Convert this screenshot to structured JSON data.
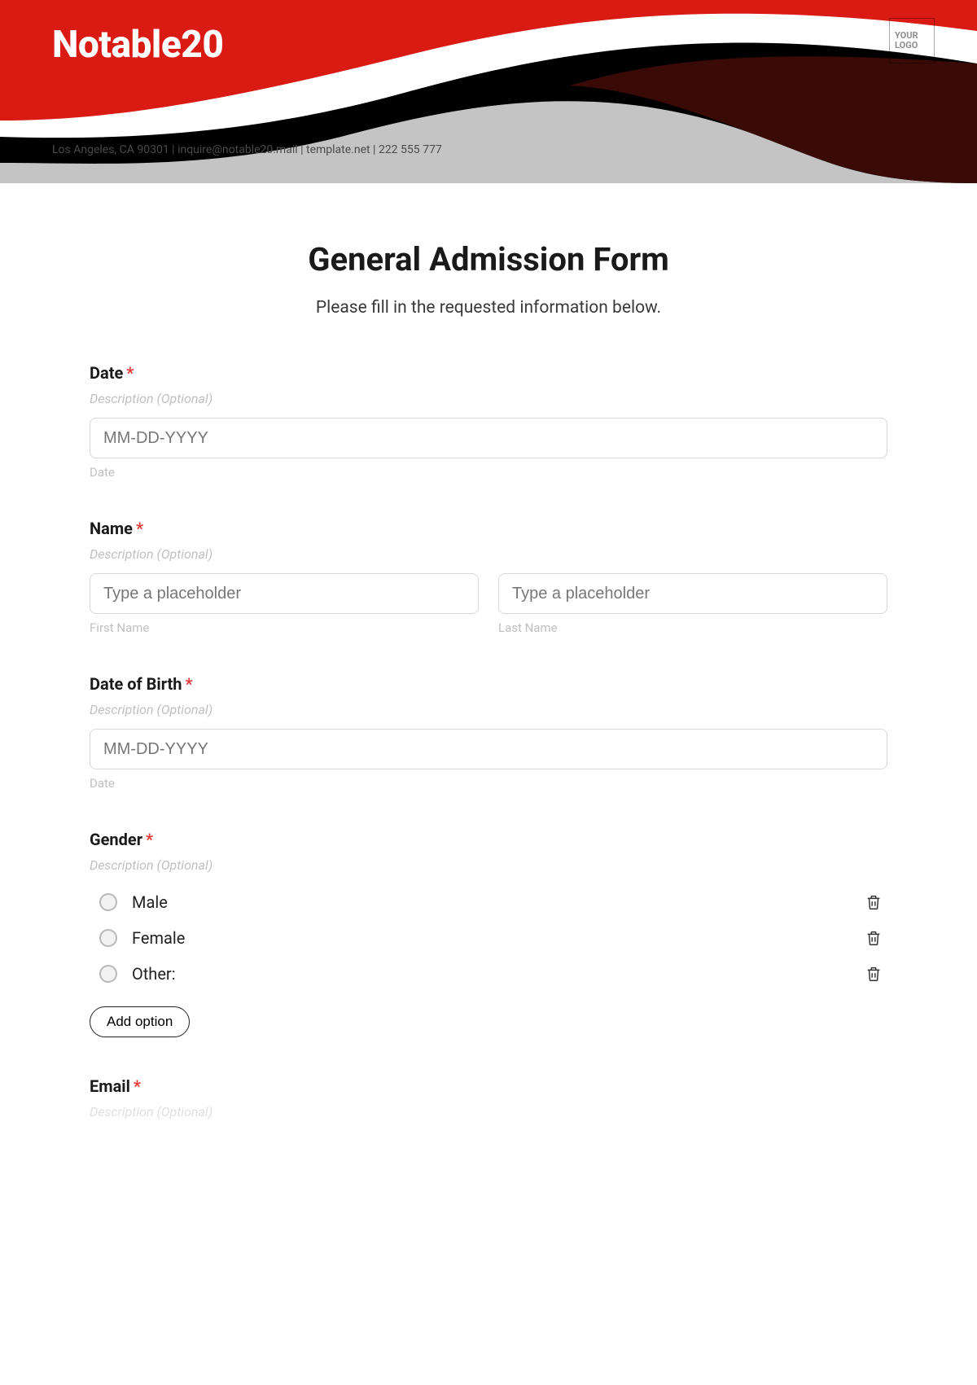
{
  "header": {
    "brand": "Notable20",
    "logo_line1": "YOUR",
    "logo_line2": "LOGO",
    "contact": "Los Angeles, CA 90301 | inquire@notable20.mail | template.net | 222 555 777"
  },
  "form": {
    "title": "General Admission Form",
    "subtitle": "Please fill in the requested information below.",
    "required_marker": "*",
    "desc_placeholder": "Description (Optional)",
    "fields": {
      "date": {
        "label": "Date",
        "placeholder": "MM-DD-YYYY",
        "sublabel": "Date"
      },
      "name": {
        "label": "Name",
        "first_placeholder": "Type a placeholder",
        "last_placeholder": "Type a placeholder",
        "first_sub": "First Name",
        "last_sub": "Last Name"
      },
      "dob": {
        "label": "Date of Birth",
        "placeholder": "MM-DD-YYYY",
        "sublabel": "Date"
      },
      "gender": {
        "label": "Gender",
        "options": [
          "Male",
          "Female",
          "Other:"
        ],
        "add_option": "Add option"
      },
      "email": {
        "label": "Email"
      }
    }
  }
}
